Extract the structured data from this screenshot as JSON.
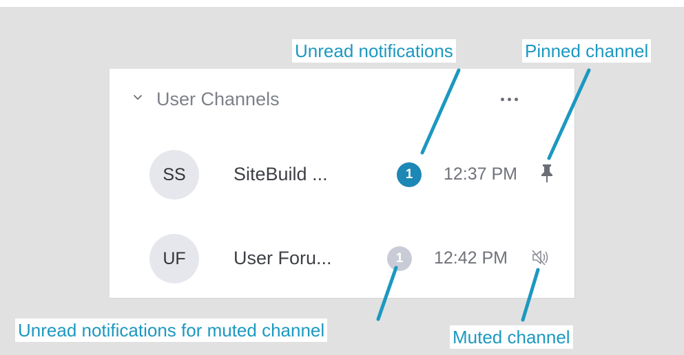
{
  "colors": {
    "callout": "#1c98c0",
    "unread_badge": "#1d87b6",
    "muted_badge": "#c9ccd6",
    "pin_icon": "#6b6e76"
  },
  "section": {
    "title": "User Channels",
    "collapse_icon": "chevron-down-icon",
    "more_icon": "more-horizontal-icon"
  },
  "channels": [
    {
      "initials": "SS",
      "name": "SiteBuild ...",
      "unread_count": "1",
      "time": "12:37 PM",
      "state": "pinned",
      "status_icon": "pin-icon"
    },
    {
      "initials": "UF",
      "name": "User Foru...",
      "unread_count": "1",
      "time": "12:42 PM",
      "state": "muted",
      "status_icon": "muted-speaker-icon"
    }
  ],
  "callouts": {
    "unread_notifications": "Unread notifications",
    "pinned_channel": "Pinned channel",
    "unread_muted": "Unread notifications for muted channel",
    "muted_channel": "Muted channel"
  }
}
